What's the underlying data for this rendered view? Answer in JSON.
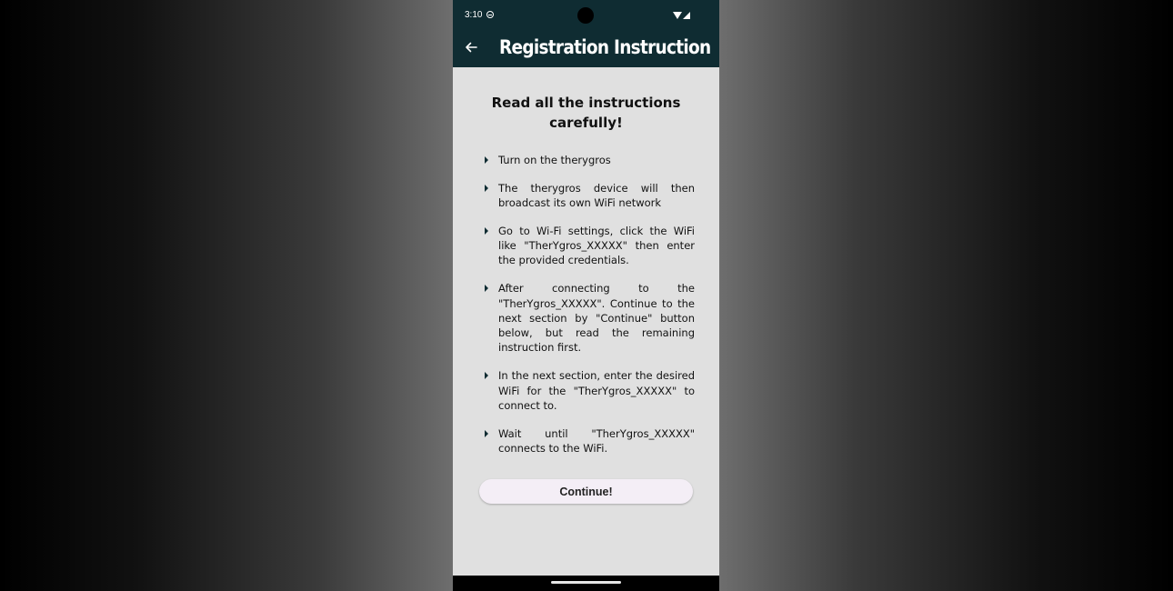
{
  "status_bar": {
    "time": "3:10",
    "icons": [
      "do-not-disturb-icon",
      "wifi-icon",
      "signal-icon"
    ]
  },
  "app_bar": {
    "title": "Registration Instruction",
    "back_icon": "arrow-left-icon",
    "background": "#0f2c32"
  },
  "main": {
    "heading": "Read all the instructions carefully!",
    "instructions": [
      "Turn on the therygros",
      "The therygros device will then broadcast its own WiFi network",
      "Go to Wi-Fi settings, click the WiFi like \"TherYgros_XXXXX\" then enter the provided credentials.",
      "After connecting to the \"TherYgros_XXXXX\". Continue to the next section by \"Continue\" button below, but read the remaining instruction first.",
      "In the next section, enter the desired WiFi for the \"TherYgros_XXXXX\" to connect to.",
      "Wait until \"TherYgros_XXXXX\" connects to the WiFi."
    ],
    "continue_label": "Continue!"
  },
  "colors": {
    "content_background": "#e0e0e0",
    "button_background": "#f4eef6"
  }
}
